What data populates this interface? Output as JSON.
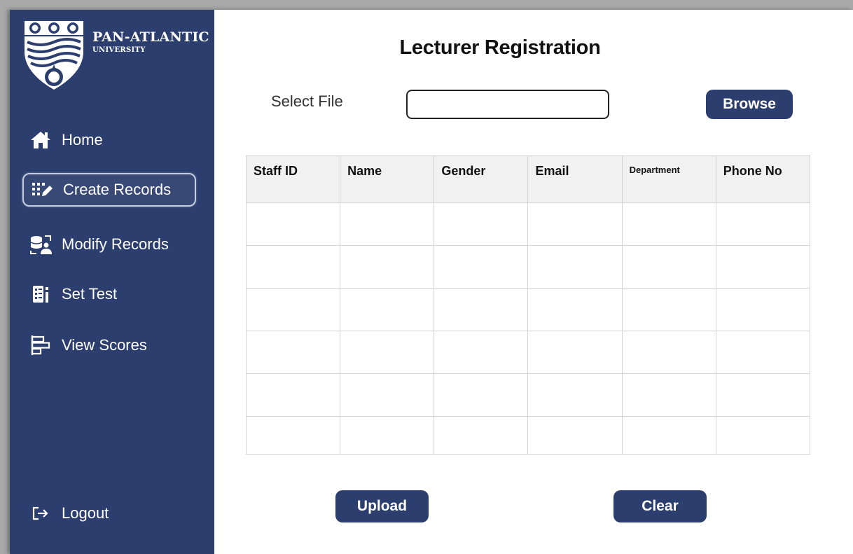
{
  "sidebar": {
    "logo": {
      "name": "PAN-ATLANTIC",
      "sub": "UNIVERSITY"
    },
    "items": [
      {
        "label": "Home",
        "icon": "home-icon"
      },
      {
        "label": "Create Records",
        "icon": "create-records-icon"
      },
      {
        "label": "Modify Records",
        "icon": "modify-records-icon"
      },
      {
        "label": "Set Test",
        "icon": "set-test-icon"
      },
      {
        "label": "View Scores",
        "icon": "view-scores-icon"
      }
    ],
    "logout": {
      "label": "Logout",
      "icon": "logout-icon"
    }
  },
  "main": {
    "title": "Lecturer Registration",
    "select_file_label": "Select File",
    "file_input": {
      "value": "",
      "placeholder": ""
    },
    "browse_label": "Browse",
    "table": {
      "columns": [
        "Staff ID",
        "Name",
        "Gender",
        "Email",
        "Department",
        "Phone No"
      ],
      "rows": [
        [
          "",
          "",
          "",
          "",
          "",
          ""
        ],
        [
          "",
          "",
          "",
          "",
          "",
          ""
        ],
        [
          "",
          "",
          "",
          "",
          "",
          ""
        ],
        [
          "",
          "",
          "",
          "",
          "",
          ""
        ],
        [
          "",
          "",
          "",
          "",
          "",
          ""
        ],
        [
          "",
          "",
          "",
          "",
          "",
          ""
        ]
      ]
    },
    "upload_label": "Upload",
    "clear_label": "Clear"
  },
  "colors": {
    "sidebar": "#2c3e6e",
    "button": "#2c3e6e",
    "header": "#f1f1f1"
  }
}
